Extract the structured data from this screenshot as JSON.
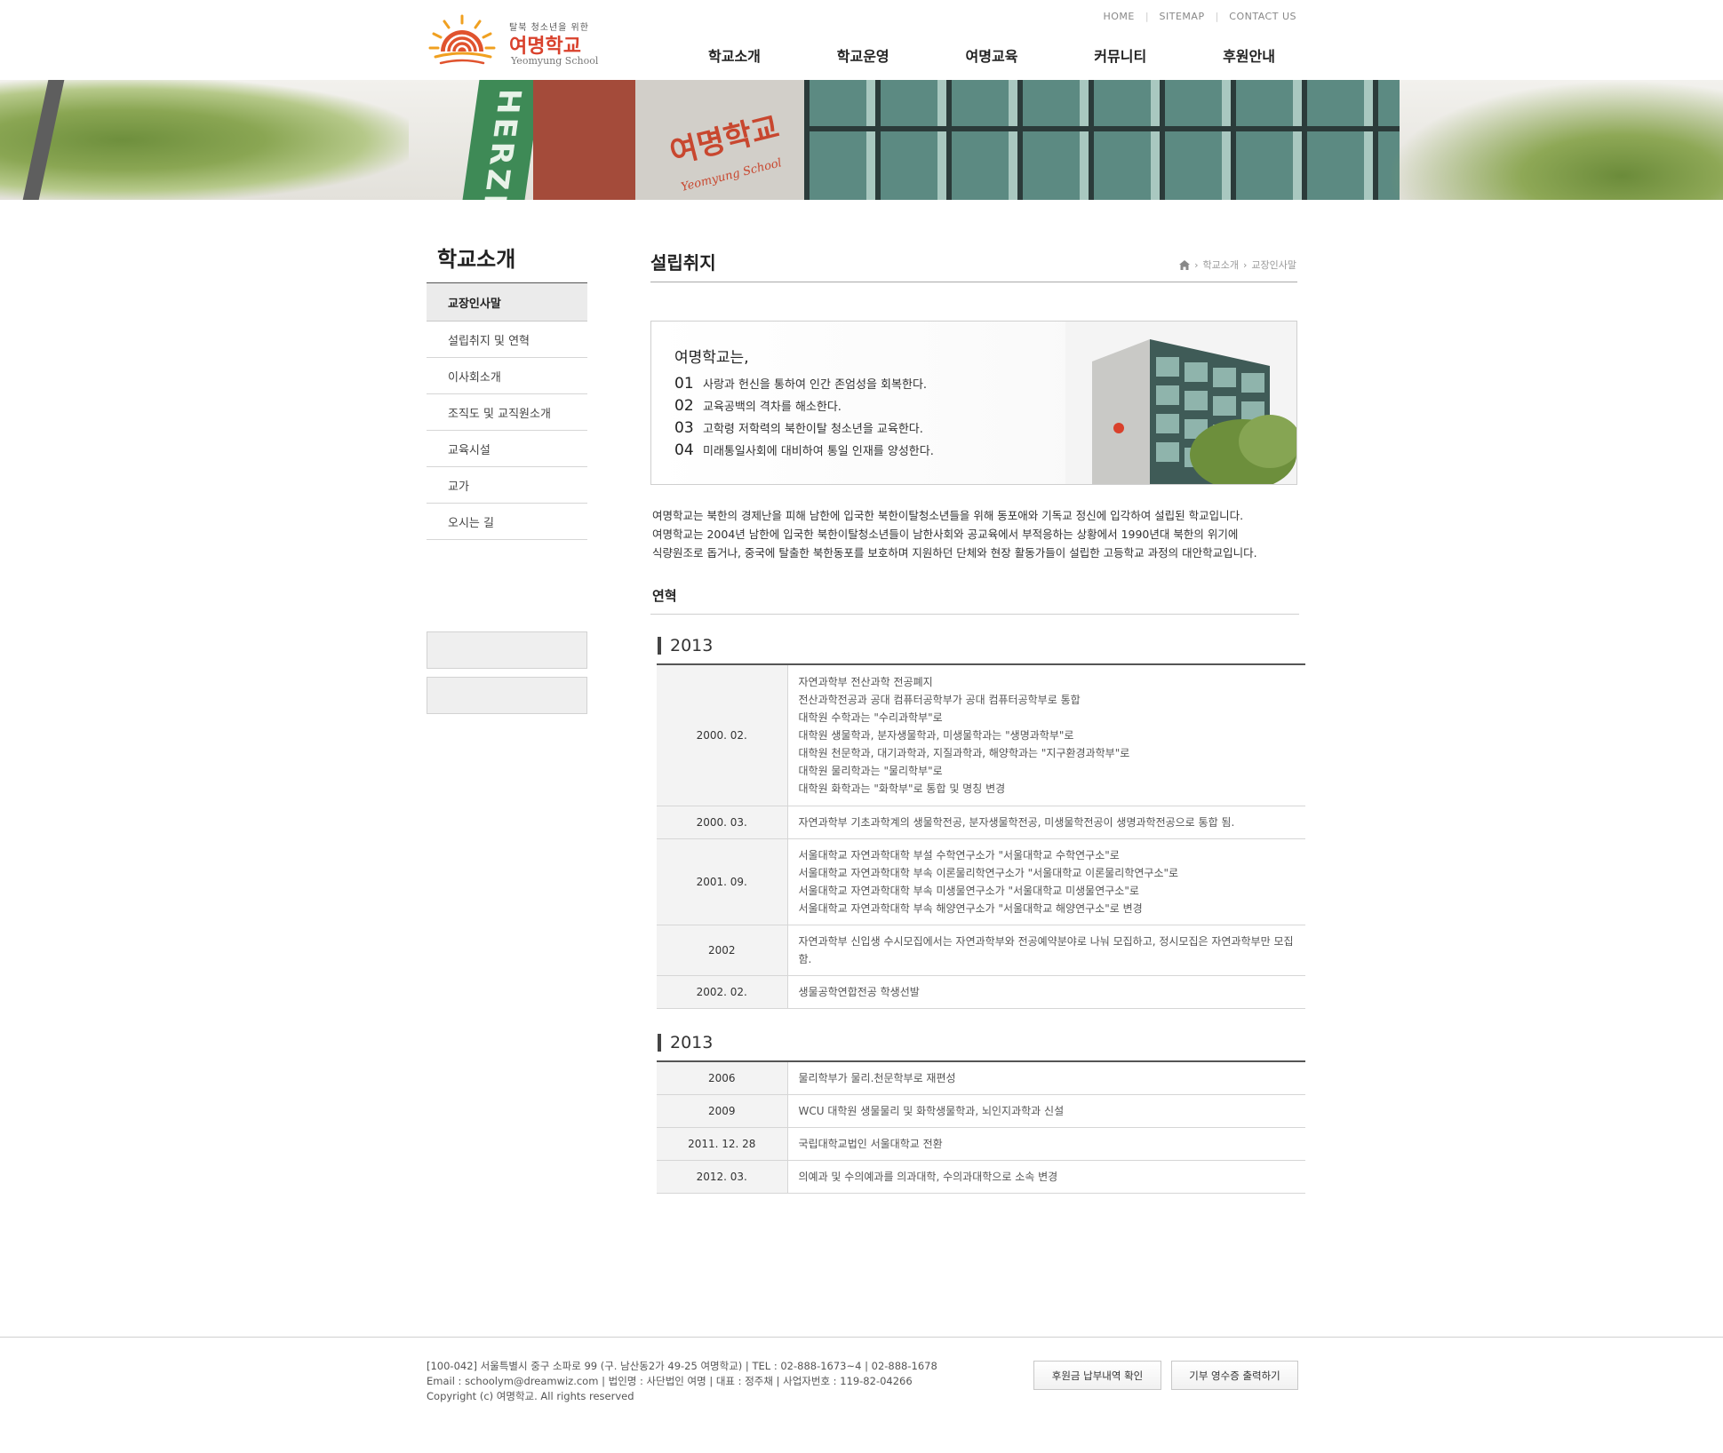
{
  "header": {
    "logo": {
      "tagline": "탈북 청소년을 위한",
      "name_kr": "여명학교",
      "name_en": "Yeomyung School"
    },
    "util_links": [
      "HOME",
      "SITEMAP",
      "CONTACT US"
    ],
    "gnb": [
      "학교소개",
      "학교운영",
      "여명교육",
      "커뮤니티",
      "후원안내"
    ]
  },
  "hero": {
    "sign_text": "HERZIA",
    "wall_sign_kr": "여명학교",
    "wall_sign_en": "Yeomyung School"
  },
  "sidebar": {
    "title": "학교소개",
    "items": [
      {
        "label": "교장인사말",
        "active": true
      },
      {
        "label": "설립취지 및 연혁",
        "active": false
      },
      {
        "label": "이사회소개",
        "active": false
      },
      {
        "label": "조직도 및 교직원소개",
        "active": false
      },
      {
        "label": "교육시설",
        "active": false
      },
      {
        "label": "교가",
        "active": false
      },
      {
        "label": "오시는 길",
        "active": false
      }
    ]
  },
  "content": {
    "title": "설립취지",
    "breadcrumb": [
      "학교소개",
      "교장인사말"
    ],
    "mission": {
      "heading": "여명학교는,",
      "items": [
        {
          "num": "01",
          "text": "사랑과 헌신을 통하여 인간 존엄성을 회복한다."
        },
        {
          "num": "02",
          "text": "교육공백의 격차를 해소한다."
        },
        {
          "num": "03",
          "text": "고학령 저학력의 북한이탈 청소년을 교육한다."
        },
        {
          "num": "04",
          "text": "미래통일사회에 대비하여 통일 인재를 양성한다."
        }
      ]
    },
    "intro": [
      "여명학교는 북한의 경제난을 피해 남한에 입국한 북한이탈청소년들을 위해 동포애와 기독교 정신에 입각하여 설립된 학교입니다.",
      "여명학교는 2004년 남한에 입국한 북한이탈청소년들이 남한사회와 공교육에서 부적응하는 상황에서 1990년대 북한의 위기에",
      "식량원조로 돕거나, 중국에 탈출한 북한동포를 보호하며 지원하던 단체와 현장 활동가들이 설립한 고등학교 과정의 대안학교입니다."
    ],
    "history_title": "연혁",
    "history": [
      {
        "year": "2013",
        "rows": [
          {
            "date": "2000. 02.",
            "lines": [
              "자연과학부 전산과학 전공폐지",
              "전산과학전공과 공대 컴퓨터공학부가 공대 컴퓨터공학부로 통합",
              "대학원 수학과는 \"수리과학부\"로",
              "대학원 생물학과, 분자생물학과, 미생물학과는 \"생명과학부\"로",
              "대학원 천문학과, 대기과학과, 지질과학과, 해양학과는 \"지구환경과학부\"로",
              "대학원 물리학과는 \"물리학부\"로",
              "대학원 화학과는 \"화학부\"로 통합 및 명칭 변경"
            ]
          },
          {
            "date": "2000. 03.",
            "lines": [
              "자연과학부 기초과학계의 생물학전공, 분자생물학전공, 미생물학전공이 생명과학전공으로 통합 됨."
            ]
          },
          {
            "date": "2001. 09.",
            "lines": [
              "서울대학교 자연과학대학 부설 수학연구소가 \"서울대학교 수학연구소\"로",
              "서울대학교 자연과학대학 부속 이론물리학연구소가 \"서울대학교 이론물리학연구소\"로",
              "서울대학교 자연과학대학 부속 미생물연구소가 \"서울대학교 미생물연구소\"로",
              "서울대학교 자연과학대학 부속 해양연구소가 \"서울대학교 해양연구소\"로 변경"
            ]
          },
          {
            "date": "2002",
            "lines": [
              "자연과학부 신입생 수시모집에서는 자연과학부와 전공예약분야로 나눠 모집하고, 정시모집은 자연과학부만 모집함."
            ]
          },
          {
            "date": "2002. 02.",
            "lines": [
              "생물공학연합전공 학생선발"
            ]
          }
        ]
      },
      {
        "year": "2013",
        "rows": [
          {
            "date": "2006",
            "lines": [
              "물리학부가 물리.천문학부로 재편성"
            ]
          },
          {
            "date": "2009",
            "lines": [
              "WCU 대학원 생물물리 및 화학생물학과, 뇌인지과학과 신설"
            ]
          },
          {
            "date": "2011. 12. 28",
            "lines": [
              "국립대학교법인 서울대학교 전환"
            ]
          },
          {
            "date": "2012. 03.",
            "lines": [
              "의예과 및 수의예과를 의과대학, 수의과대학으로 소속 변경"
            ]
          }
        ]
      }
    ]
  },
  "footer": {
    "lines": [
      "[100-042] 서울특별시 중구 소파로 99 (구. 남산동2가 49-25 여명학교) | TEL : 02-888-1673~4 | 02-888-1678",
      "Email : schoolym@dreamwiz.com | 법인명 : 사단법인 여명 | 대표 : 정주채 | 사업자번호 : 119-82-04266",
      "Copyright (c) 여명학교. All rights reserved"
    ],
    "buttons": [
      "후원금 납부내역 확인",
      "기부 영수증 출력하기"
    ]
  },
  "colors": {
    "brand": "#d9412c",
    "sidebar_active_bg": "#ebebeb",
    "table_date_bg": "#f3f3f3"
  }
}
